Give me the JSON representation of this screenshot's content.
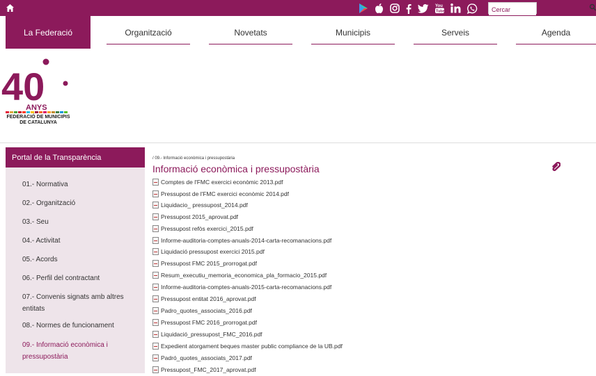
{
  "topbar": {
    "search_placeholder": "Cercar",
    "social_icons": [
      "google-play-icon",
      "apple-icon",
      "instagram-icon",
      "facebook-icon",
      "twitter-icon",
      "youtube-icon",
      "linkedin-icon",
      "whatsapp-icon"
    ]
  },
  "nav": {
    "items": [
      {
        "label": "La Federació"
      },
      {
        "label": "Organització"
      },
      {
        "label": "Novetats"
      },
      {
        "label": "Municipis"
      },
      {
        "label": "Serveis"
      },
      {
        "label": "Agenda"
      }
    ]
  },
  "logo": {
    "number": "40",
    "years": "ANYS",
    "org_line1": "FEDERACIÓ DE MUNICIPIS",
    "org_line2": "DE CATALUNYA"
  },
  "sidebar": {
    "title": "Portal de la Transparència",
    "items": [
      {
        "label": "01.- Normativa"
      },
      {
        "label": "02.- Organització"
      },
      {
        "label": "03.- Seu"
      },
      {
        "label": "04.- Activitat"
      },
      {
        "label": "05.- Acords"
      },
      {
        "label": "06.- Perfil del contractant"
      },
      {
        "label": "07.- Convenis signats amb altres entitats"
      },
      {
        "label": "08.- Normes de funcionament"
      },
      {
        "label": "09.- Informació econòmica i pressupostària"
      }
    ]
  },
  "main": {
    "breadcrumb": "/ 09.- Informació econòmica i pressupostària",
    "title": "Informació econòmica i pressupostària",
    "documents": [
      "Comptes de l'FMC exercici econòmic 2013.pdf",
      "Pressupost de l'FMC exercici econòmic 2014.pdf",
      "Liquidacio_ pressupost_2014.pdf",
      "Pressupost 2015_aprovat.pdf",
      "Pressupost refòs exercici_2015.pdf",
      "Informe-auditoria-comptes-anuals-2014-carta-recomanacions.pdf",
      "Liquidació pressupost exercici 2015.pdf",
      "Pressupost FMC 2015_prorrogat.pdf",
      "Resum_executiu_memoria_economica_pla_formacio_2015.pdf",
      "Informe-auditoria-comptes-anuals-2015-carta-recomanacions.pdf",
      "Pressupost entitat 2016_aprovat.pdf",
      "Padro_quotes_associats_2016.pdf",
      "Pressupost FMC 2016_prorrogat.pdf",
      "Liquidació_pressupost_FMC_2016.pdf",
      "Expedient atorgament beques master public compliance de la UB.pdf",
      "Padró_quotes_associats_2017.pdf",
      "Pressupost_FMC_2017_aprovat.pdf"
    ]
  },
  "colors": {
    "brand": "#8c1a5b",
    "sidebar_bg": "#eee4ea"
  }
}
